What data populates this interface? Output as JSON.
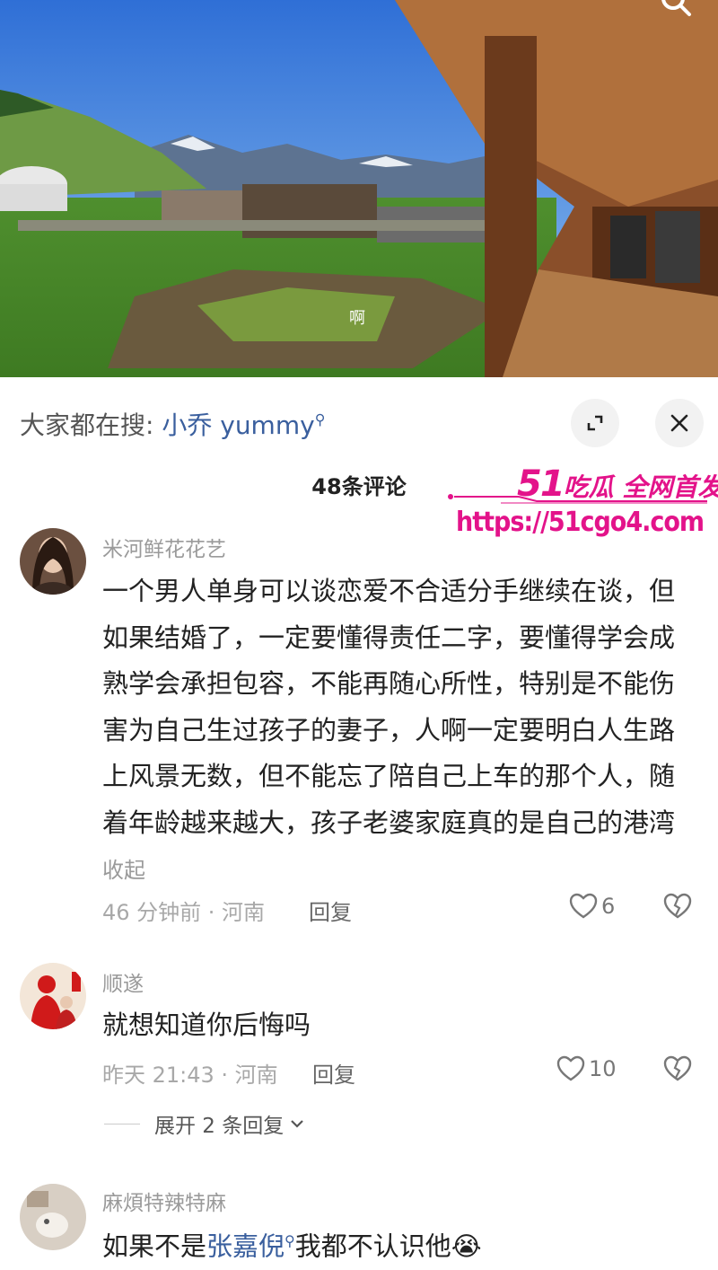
{
  "search": {
    "prefix": "大家都在搜:",
    "term": "小乔 yummy"
  },
  "comments_count": "48条评论",
  "watermark": {
    "title_num": "51",
    "title_rest": "吃瓜 全网首发",
    "url": "https://51cgo4.com"
  },
  "comments": [
    {
      "user": "米河鲜花花艺",
      "text": "一个男人单身可以谈恋爱不合适分手继续在谈，但如果结婚了，一定要懂得责任二字，要懂得学会成熟学会承担包容，不能再随心所性，特别是不能伤害为自己生过孩子的妻子，人啊一定要明白人生路上风景无数，但不能忘了陪自己上车的那个人，随着年龄越来越大，孩子老婆家庭真的是自己的港湾",
      "collapse": "收起",
      "time_loc": "46 分钟前 · 河南",
      "reply": "回复",
      "likes": "6"
    },
    {
      "user": "顺遂",
      "text": "就想知道你后悔吗",
      "time_loc": "昨天 21:43 · 河南",
      "reply": "回复",
      "likes": "10",
      "expand": "展开 2 条回复"
    },
    {
      "user": "麻煩特辣特麻",
      "text_pre": "如果不是",
      "mention": "张嘉倪",
      "text_post": "我都不认识他",
      "emoji": "😭"
    }
  ],
  "colors": {
    "accent": "#e3138a",
    "link": "#3a5f9e"
  }
}
